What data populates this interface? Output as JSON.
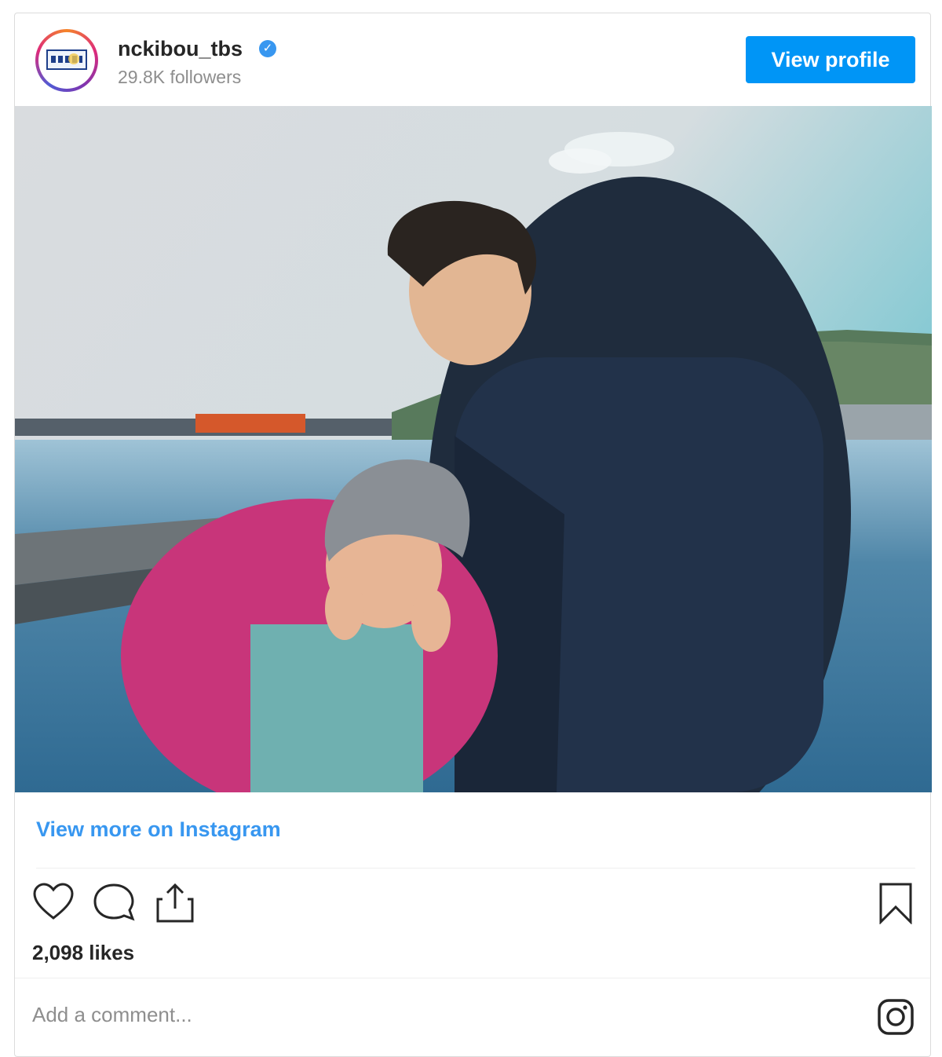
{
  "post": {
    "username": "nckibou_tbs",
    "followers": "29.8K followers",
    "view_profile_label": "View profile",
    "view_more_label": "View more on Instagram",
    "likes": "2,098 likes",
    "comment_placeholder": "Add a comment...",
    "photo_alt": "Two people posing by a harbor"
  },
  "icons": {
    "verified": "verified-badge-icon",
    "like": "heart-icon",
    "comment": "comment-bubble-icon",
    "share": "share-icon",
    "save": "bookmark-icon",
    "instagram": "instagram-logo-icon"
  },
  "colors": {
    "accent": "#0095f6",
    "link": "#3897f0",
    "verified": "#3897f0"
  }
}
